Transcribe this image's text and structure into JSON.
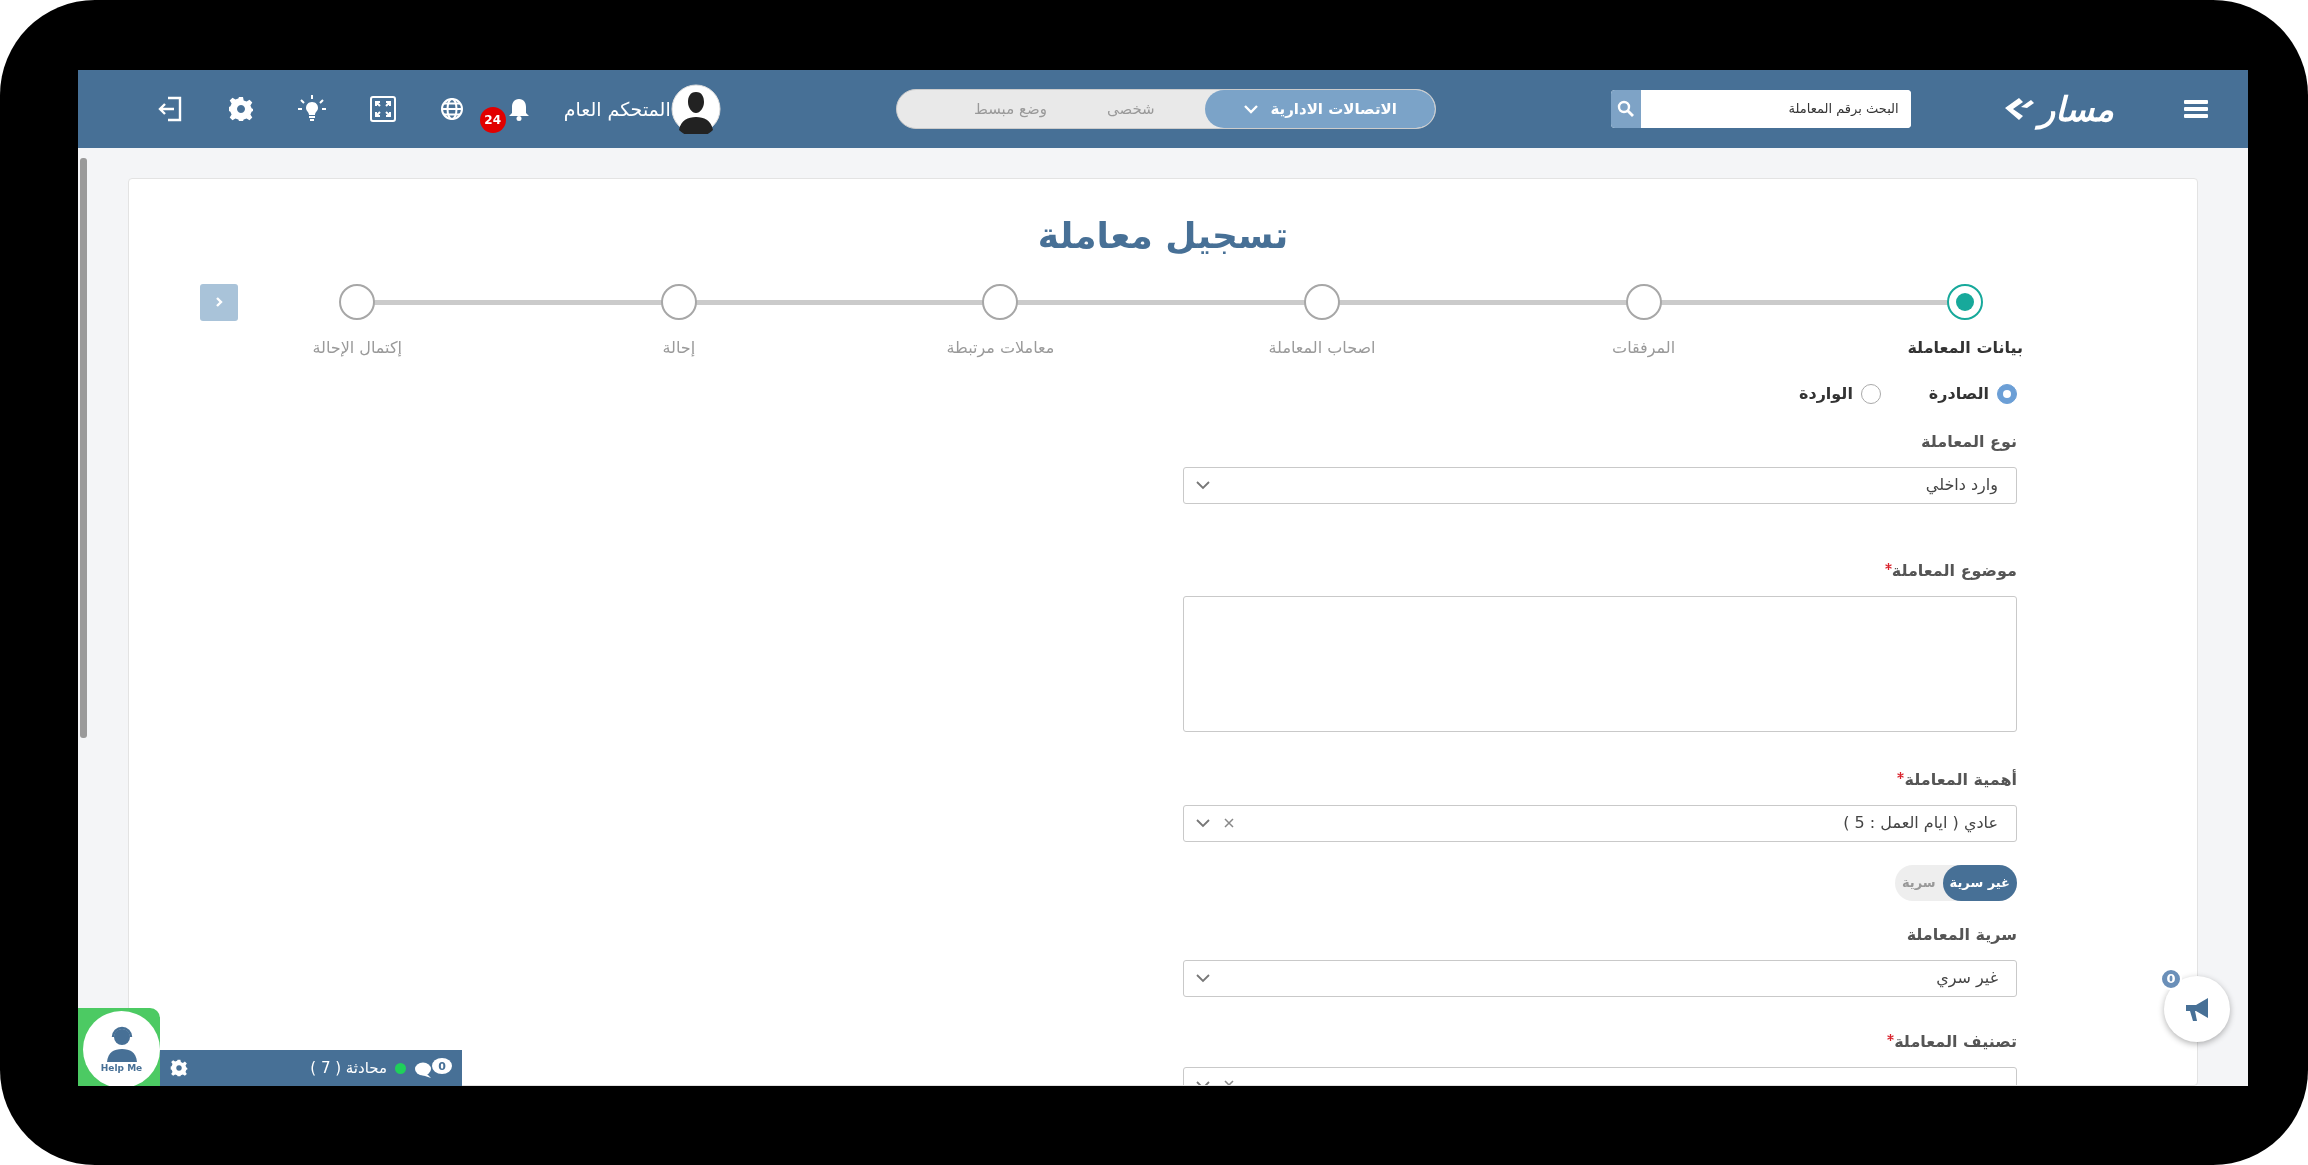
{
  "header": {
    "logo": "مسار",
    "search": {
      "placeholder": "البحث برقم المعاملة"
    },
    "modes": [
      {
        "label": "الاتصالات الادارية",
        "selected": true
      },
      {
        "label": "شخصى",
        "selected": false
      },
      {
        "label": "وضع مبسط",
        "selected": false
      }
    ],
    "user": {
      "name": "المتحكم العام"
    },
    "notifications": {
      "count": "24"
    }
  },
  "page": {
    "title": "تسجيل معاملة"
  },
  "steps": [
    {
      "label": "بيانات المعاملة",
      "selected": true
    },
    {
      "label": "المرفقات",
      "selected": false
    },
    {
      "label": "اصحاب المعاملة",
      "selected": false
    },
    {
      "label": "معاملات مرتبطة",
      "selected": false
    },
    {
      "label": "إحالة",
      "selected": false
    },
    {
      "label": "إكتمال الإحالة",
      "selected": false
    }
  ],
  "direction": [
    {
      "label": "الصادرة",
      "selected": true
    },
    {
      "label": "الواردة",
      "selected": false
    }
  ],
  "fields": [
    {
      "kind": "select",
      "label": "نوع المعاملة",
      "required": false,
      "value": "وارد داخلي",
      "clearable": false
    },
    {
      "kind": "textarea",
      "label": "موضوع المعاملة",
      "required": true
    },
    {
      "kind": "select",
      "label": "أهمية المعاملة",
      "required": true,
      "value": "عادي ( ايام العمل : 5 )",
      "clearable": true
    },
    {
      "kind": "toggle",
      "options": [
        {
          "label": "غير سرية",
          "selected": true
        },
        {
          "label": "سرية",
          "selected": false
        }
      ]
    },
    {
      "kind": "select",
      "label": "سرية المعاملة",
      "required": false,
      "value": "غير سري",
      "clearable": false
    },
    {
      "kind": "select",
      "label": "تصنيف المعاملة",
      "required": true,
      "clearable": true
    }
  ],
  "help": {
    "label": "Help Me"
  },
  "chat": {
    "label": "محادثة ( 7 )",
    "unread": "0",
    "online": true
  },
  "announcements": {
    "count": "0"
  }
}
